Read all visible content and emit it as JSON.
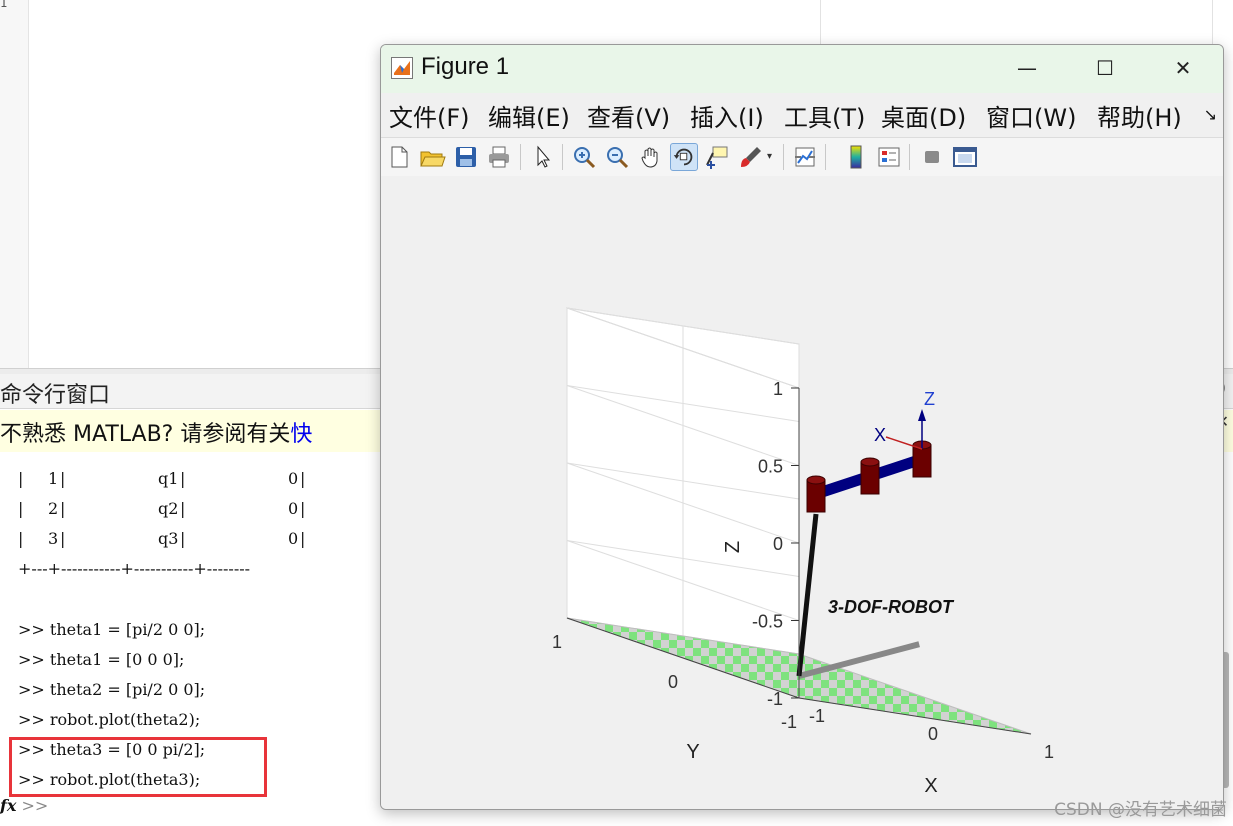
{
  "editor": {
    "gutter_mark": "1"
  },
  "command_window": {
    "title": "命令行窗口",
    "hint_prefix": "不熟悉 MATLAB? 请参阅有关",
    "hint_link": "快",
    "hint_close": "✕",
    "table_rows": [
      {
        "j": "1",
        "theta": "q1",
        "d": "0"
      },
      {
        "j": "2",
        "theta": "q2",
        "d": "0"
      },
      {
        "j": "3",
        "theta": "q3",
        "d": "0"
      }
    ],
    "table_border": "+---+-----------+-----------+--------",
    "lines": [
      ">> theta1 = [pi/2 0 0];",
      ">> theta1 = [0 0 0];",
      ">> theta2 = [pi/2 0 0];",
      ">> robot.plot(theta2);",
      ">> theta3 = [0 0 pi/2];",
      ">> robot.plot(theta3);"
    ],
    "prompt_icon": "fx",
    "prompt": ">>"
  },
  "figure": {
    "title": "Figure 1",
    "window_buttons": {
      "minimize": "—",
      "maximize": "☐",
      "close": "✕"
    },
    "menus": [
      "文件(F)",
      "编辑(E)",
      "查看(V)",
      "插入(I)",
      "工具(T)",
      "桌面(D)",
      "窗口(W)",
      "帮助(H)"
    ],
    "menu_more": "↘",
    "toolbar": [
      "new-figure-icon",
      "open-file-icon",
      "save-icon",
      "print-icon",
      "pointer-icon",
      "zoom-in-icon",
      "zoom-out-icon",
      "pan-hand-icon",
      "rotate-3d-icon",
      "data-cursor-icon",
      "brush-icon",
      "link-plot-icon",
      "colorbar-icon",
      "legend-icon",
      "hide-plot-tools-icon",
      "show-plot-tools-icon"
    ],
    "colors": {
      "title_bar": "#e9f6e9",
      "link_color": "#000080",
      "joint_color": "#6b0000",
      "floor_green": "#7ee27e"
    }
  },
  "chart_data": {
    "type": "3d-robot-plot",
    "title": "",
    "robot_name": "3-DOF-ROBOT",
    "xlabel": "X",
    "ylabel": "Y",
    "zlabel": "Z",
    "xlim": [
      -1,
      1
    ],
    "ylim": [
      -1,
      1
    ],
    "zlim": [
      -1,
      1
    ],
    "x_ticks": [
      "1",
      "0",
      "-1"
    ],
    "y_ticks": [
      "1",
      "0",
      "-1"
    ],
    "z_ticks": [
      "1",
      "0.5",
      "0",
      "-0.5",
      "-1"
    ],
    "grid": true,
    "frame_axes": {
      "x": "X",
      "z": "Z"
    }
  },
  "watermark": "CSDN @没有艺术细菌"
}
